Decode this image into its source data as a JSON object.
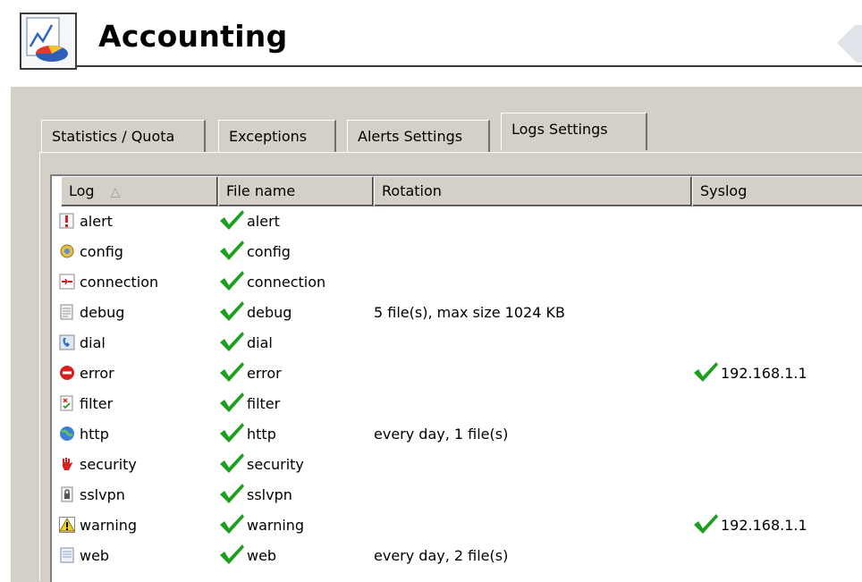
{
  "header": {
    "title": "Accounting",
    "app_icon": "accounting-chart-icon"
  },
  "tabs": [
    {
      "label": "Statistics / Quota",
      "active": false
    },
    {
      "label": "Exceptions",
      "active": false
    },
    {
      "label": "Alerts Settings",
      "active": false
    },
    {
      "label": "Logs Settings",
      "active": true
    }
  ],
  "columns": {
    "log": "Log",
    "file_name": "File name",
    "rotation": "Rotation",
    "syslog": "Syslog"
  },
  "colors": {
    "check": "#1e9e1e",
    "panel": "#d4d0c8"
  },
  "rows": [
    {
      "log": "alert",
      "icon": "alert-icon",
      "file_name": "alert",
      "rotation": "",
      "syslog": ""
    },
    {
      "log": "config",
      "icon": "config-icon",
      "file_name": "config",
      "rotation": "",
      "syslog": ""
    },
    {
      "log": "connection",
      "icon": "connection-icon",
      "file_name": "connection",
      "rotation": "",
      "syslog": ""
    },
    {
      "log": "debug",
      "icon": "debug-icon",
      "file_name": "debug",
      "rotation": "5 file(s), max size 1024 KB",
      "syslog": ""
    },
    {
      "log": "dial",
      "icon": "dial-icon",
      "file_name": "dial",
      "rotation": "",
      "syslog": ""
    },
    {
      "log": "error",
      "icon": "error-icon",
      "file_name": "error",
      "rotation": "",
      "syslog": "192.168.1.1"
    },
    {
      "log": "filter",
      "icon": "filter-icon",
      "file_name": "filter",
      "rotation": "",
      "syslog": ""
    },
    {
      "log": "http",
      "icon": "http-icon",
      "file_name": "http",
      "rotation": "every day, 1 file(s)",
      "syslog": ""
    },
    {
      "log": "security",
      "icon": "security-icon",
      "file_name": "security",
      "rotation": "",
      "syslog": ""
    },
    {
      "log": "sslvpn",
      "icon": "sslvpn-icon",
      "file_name": "sslvpn",
      "rotation": "",
      "syslog": ""
    },
    {
      "log": "warning",
      "icon": "warning-icon",
      "file_name": "warning",
      "rotation": "",
      "syslog": "192.168.1.1"
    },
    {
      "log": "web",
      "icon": "web-icon",
      "file_name": "web",
      "rotation": "every day, 2 file(s)",
      "syslog": ""
    }
  ]
}
